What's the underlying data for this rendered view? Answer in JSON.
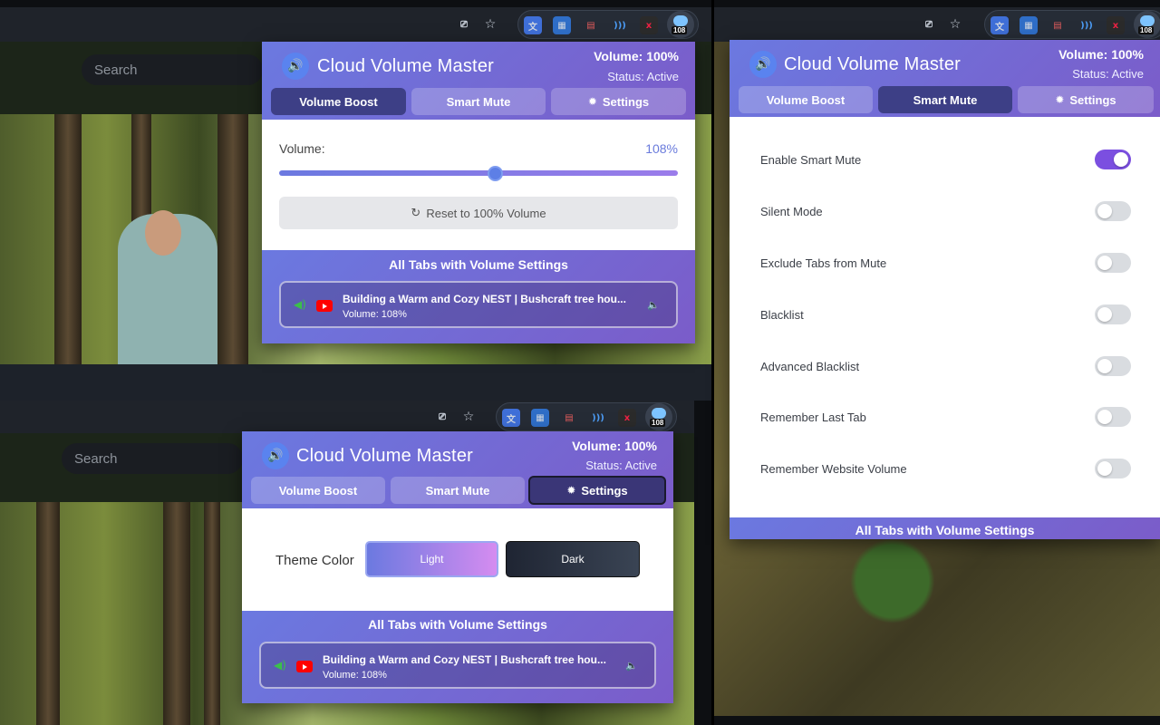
{
  "browser": {
    "search_placeholder": "Search",
    "extension_badge": "108"
  },
  "popup": {
    "title": "Cloud Volume Master",
    "volume_status": "Volume: 100%",
    "status": "Status: Active",
    "tabs": [
      {
        "label": "Volume Boost"
      },
      {
        "label": "Smart Mute"
      },
      {
        "label": "Settings"
      }
    ],
    "boost": {
      "label": "Volume:",
      "value_text": "108%",
      "slider_fraction": 0.54,
      "reset_label": "Reset to 100% Volume"
    },
    "all_tabs_title": "All Tabs with Volume Settings",
    "tab_entry": {
      "title": "Building a Warm and Cozy NEST | Bushcraft tree hou...",
      "volume": "Volume: 108%"
    },
    "smart_mute": {
      "options": [
        {
          "label": "Enable Smart Mute",
          "on": true
        },
        {
          "label": "Silent Mode",
          "on": false
        },
        {
          "label": "Exclude Tabs from Mute",
          "on": false
        },
        {
          "label": "Blacklist",
          "on": false
        },
        {
          "label": "Advanced Blacklist",
          "on": false
        },
        {
          "label": "Remember Last Tab",
          "on": false
        },
        {
          "label": "Remember Website Volume",
          "on": false
        }
      ]
    },
    "settings": {
      "theme_label": "Theme Color",
      "light_label": "Light",
      "dark_label": "Dark"
    }
  },
  "colors": {
    "header_start": "#6b79e0",
    "header_end": "#7b5cc9",
    "slider_thumb": "#5d7fe6",
    "toggle_on": "#7b4fe0"
  }
}
